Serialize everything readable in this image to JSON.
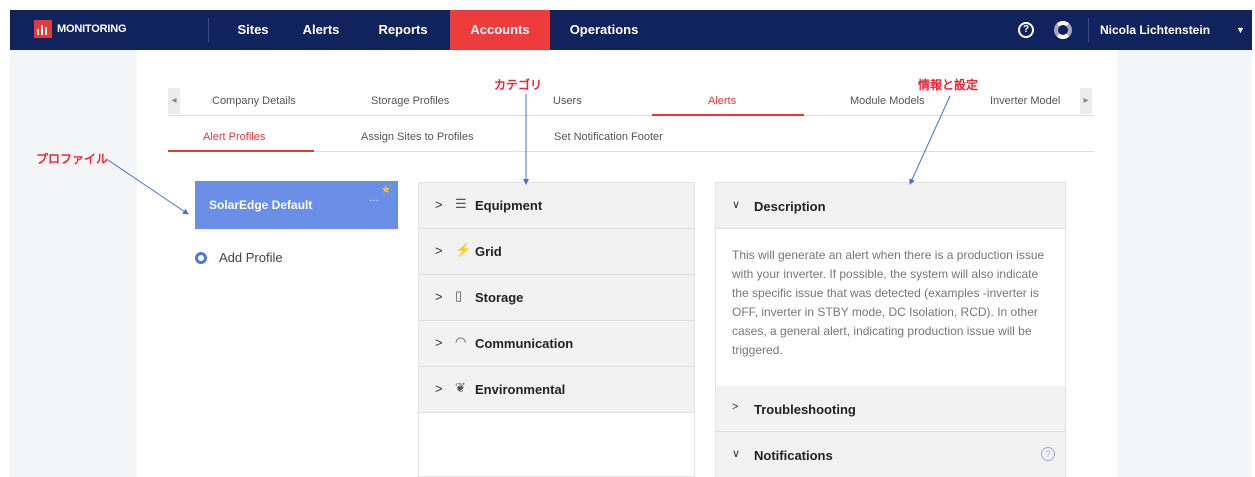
{
  "app": {
    "brand": "MONITORING"
  },
  "nav": {
    "items": [
      {
        "label": "Sites"
      },
      {
        "label": "Alerts"
      },
      {
        "label": "Reports"
      },
      {
        "label": "Accounts"
      },
      {
        "label": "Operations"
      }
    ],
    "user": "Nicola Lichtenstein",
    "colors": {
      "bar": "#10235c",
      "active": "#ee3b3b"
    }
  },
  "tabs_primary": {
    "items": [
      {
        "label": "Company Details"
      },
      {
        "label": "Storage Profiles"
      },
      {
        "label": "Users"
      },
      {
        "label": "Alerts"
      },
      {
        "label": "Module Models"
      },
      {
        "label": "Inverter Model"
      }
    ],
    "selected": "Alerts"
  },
  "tabs_secondary": {
    "items": [
      {
        "label": "Alert Profiles"
      },
      {
        "label": "Assign Sites to Profiles"
      },
      {
        "label": "Set Notification Footer"
      }
    ],
    "selected": "Alert Profiles"
  },
  "profiles": {
    "default_name": "SolarEdge Default",
    "more": "···",
    "add_label": "Add Profile"
  },
  "categories": [
    {
      "label": "Equipment",
      "icon": "equipment-icon"
    },
    {
      "label": "Grid",
      "icon": "grid-tower-icon"
    },
    {
      "label": "Storage",
      "icon": "battery-icon"
    },
    {
      "label": "Communication",
      "icon": "wifi-icon"
    },
    {
      "label": "Environmental",
      "icon": "leaf-icon"
    }
  ],
  "info": {
    "description_label": "Description",
    "description_text": "This will generate an alert when there is a production issue with your inverter. If possible, the system will also indicate the specific issue that was detected (examples -inverter is OFF, inverter in STBY mode, DC Isolation, RCD). In other cases, a general alert, indicating production issue will be triggered.",
    "troubleshooting_label": "Troubleshooting",
    "notifications_label": "Notifications"
  },
  "annotations": {
    "category": "カテゴリ",
    "info": "情報と設定",
    "profile": "プロファイル"
  }
}
